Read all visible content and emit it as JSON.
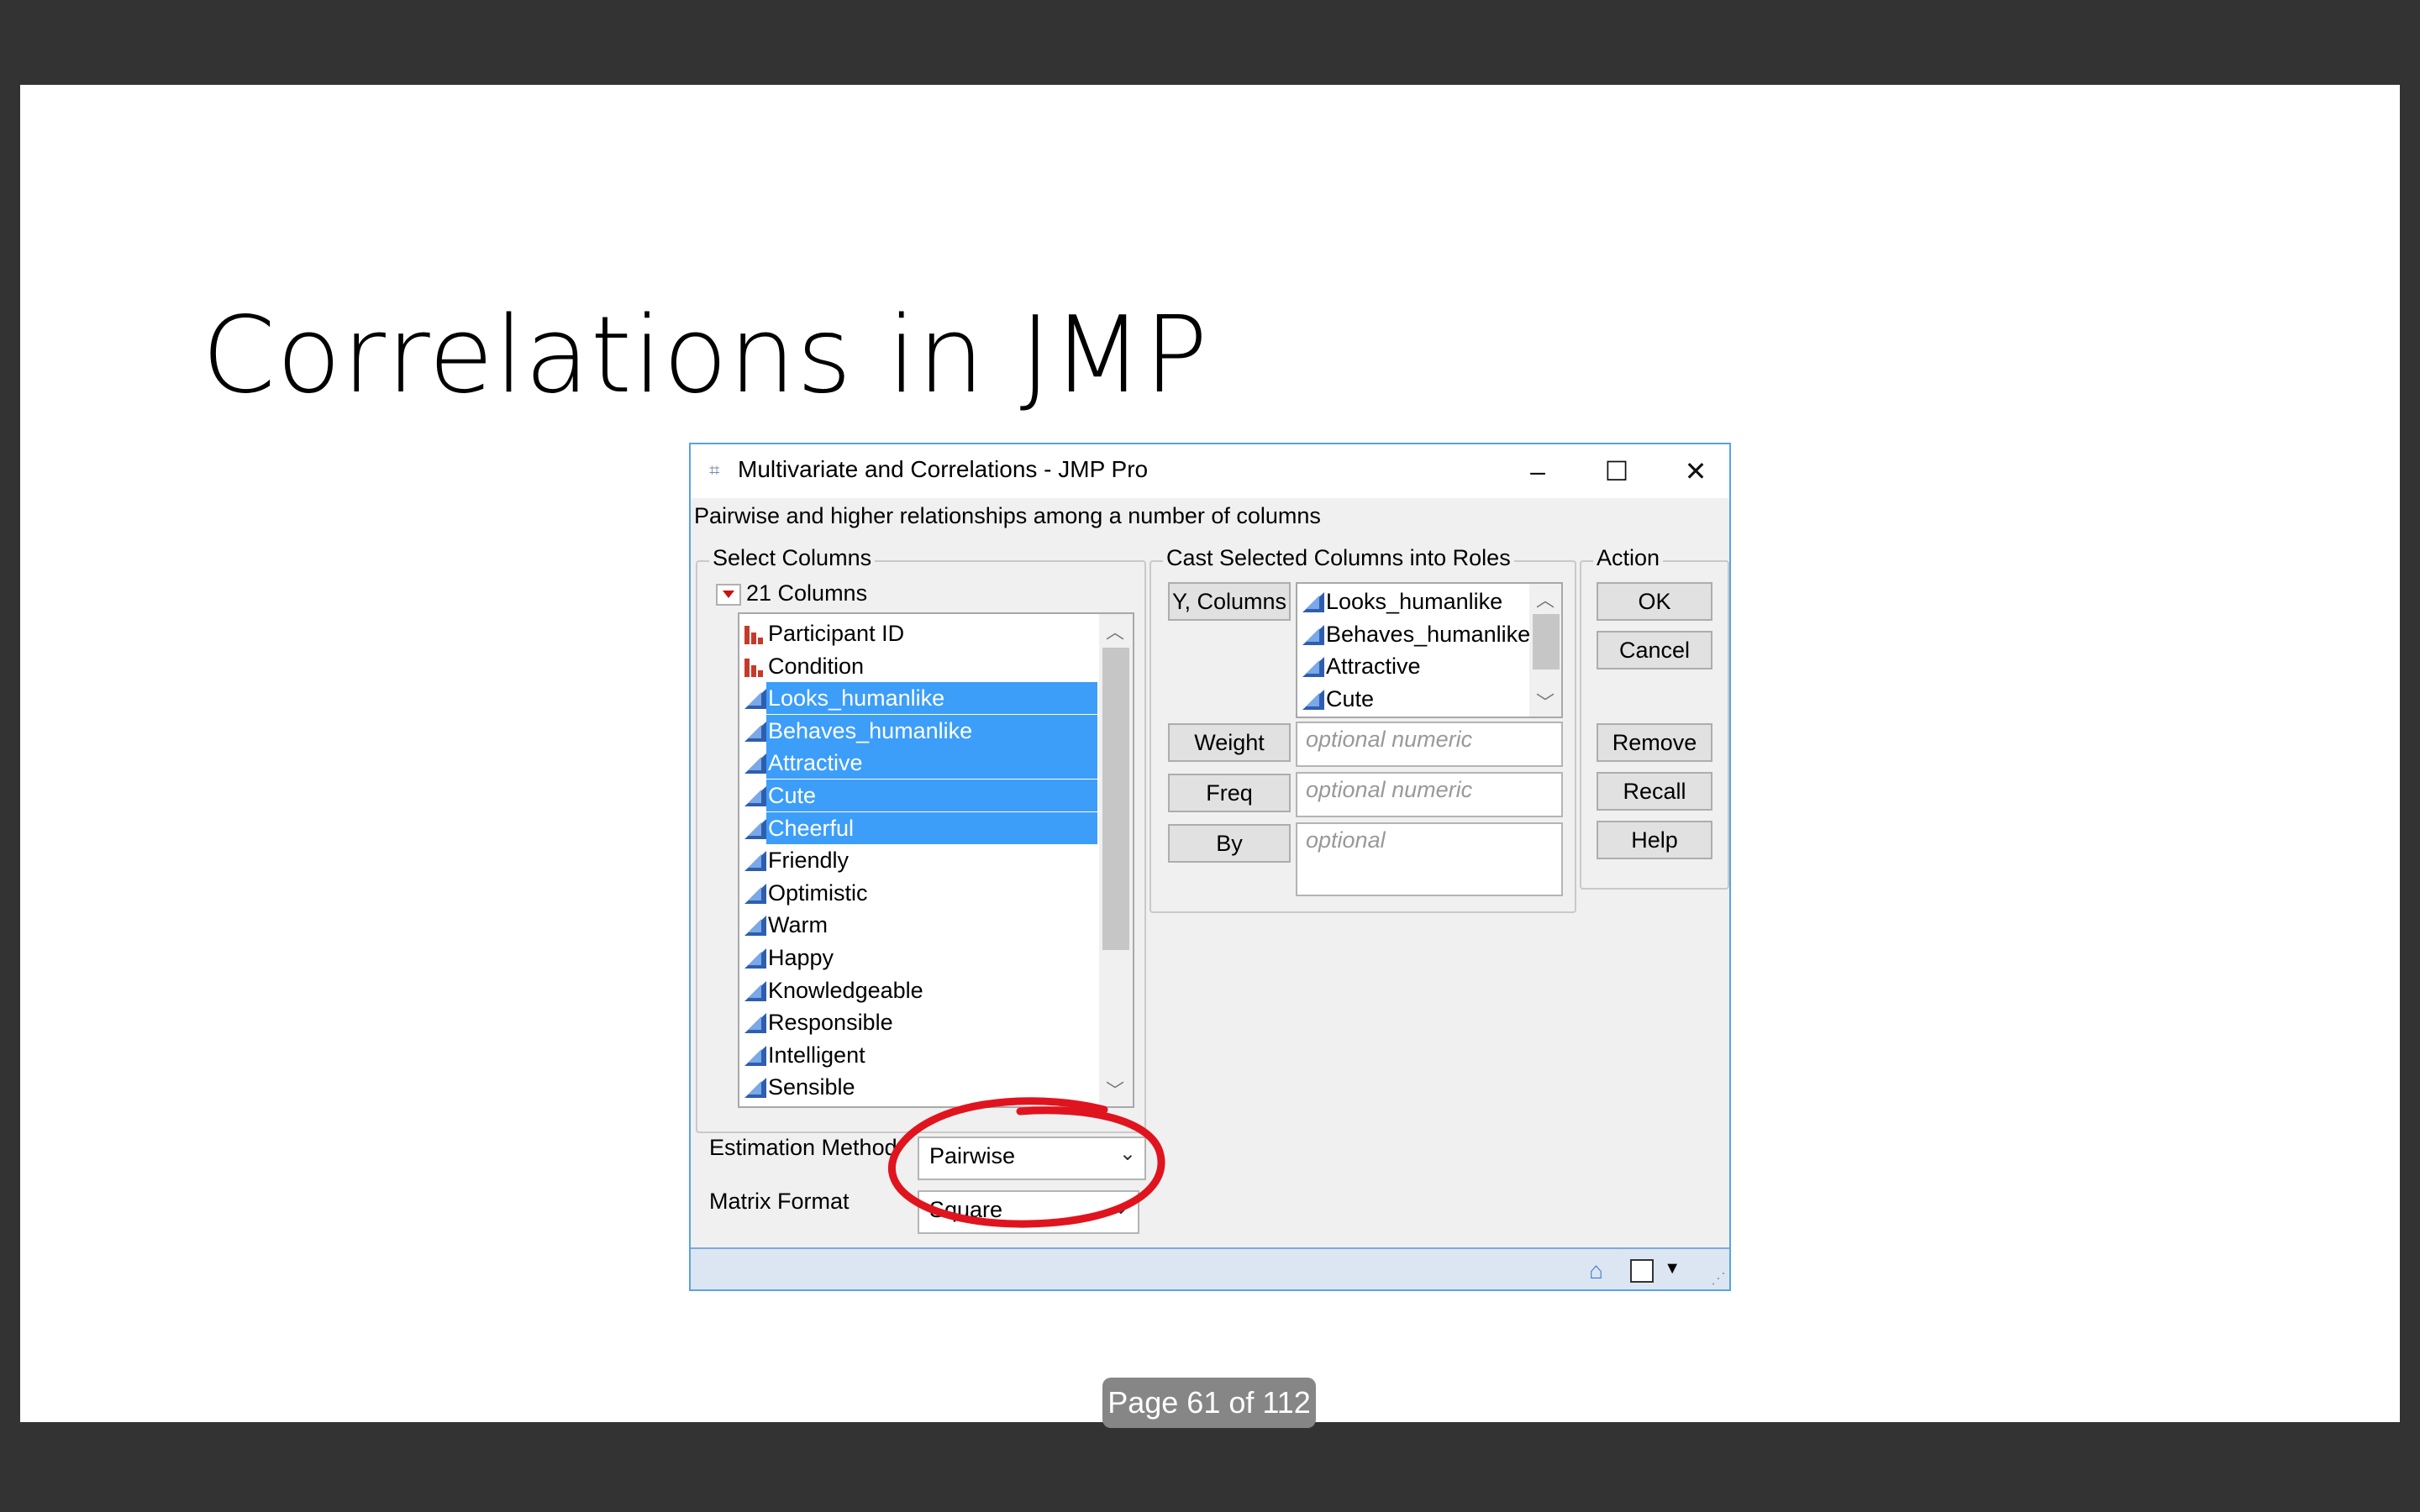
{
  "slide": {
    "title": "Correlations in JMP",
    "page_indicator": "Page 61 of 112"
  },
  "dialog": {
    "window_title": "Multivariate and Correlations - JMP Pro",
    "subtitle": "Pairwise and higher relationships among a number of columns",
    "icons": {
      "app": "app-icon",
      "minimize": "minimize-icon",
      "maximize": "maximize-icon",
      "close": "close-icon"
    },
    "select_columns": {
      "group_label": "Select Columns",
      "count_label": "21 Columns",
      "items": [
        {
          "label": "Participant ID",
          "type": "nominal",
          "selected": false
        },
        {
          "label": "Condition",
          "type": "nominal",
          "selected": false
        },
        {
          "label": "Looks_humanlike",
          "type": "continuous",
          "selected": true
        },
        {
          "label": "Behaves_humanlike",
          "type": "continuous",
          "selected": true
        },
        {
          "label": "Attractive",
          "type": "continuous",
          "selected": true
        },
        {
          "label": "Cute",
          "type": "continuous",
          "selected": true
        },
        {
          "label": "Cheerful",
          "type": "continuous",
          "selected": true
        },
        {
          "label": "Friendly",
          "type": "continuous",
          "selected": false
        },
        {
          "label": "Optimistic",
          "type": "continuous",
          "selected": false
        },
        {
          "label": "Warm",
          "type": "continuous",
          "selected": false
        },
        {
          "label": "Happy",
          "type": "continuous",
          "selected": false
        },
        {
          "label": "Knowledgeable",
          "type": "continuous",
          "selected": false
        },
        {
          "label": "Responsible",
          "type": "continuous",
          "selected": false
        },
        {
          "label": "Intelligent",
          "type": "continuous",
          "selected": false
        },
        {
          "label": "Sensible",
          "type": "continuous",
          "selected": false
        }
      ]
    },
    "cast_roles": {
      "group_label": "Cast Selected Columns into Roles",
      "y_columns_button": "Y, Columns",
      "y_items": [
        "Looks_humanlike",
        "Behaves_humanlike",
        "Attractive",
        "Cute"
      ],
      "weight_button": "Weight",
      "weight_placeholder": "optional numeric",
      "freq_button": "Freq",
      "freq_placeholder": "optional numeric",
      "by_button": "By",
      "by_placeholder": "optional"
    },
    "action": {
      "group_label": "Action",
      "ok": "OK",
      "cancel": "Cancel",
      "remove": "Remove",
      "recall": "Recall",
      "help": "Help"
    },
    "options": {
      "estimation_label": "Estimation Method",
      "estimation_value": "Pairwise",
      "matrix_label": "Matrix Format",
      "matrix_value": "Square"
    },
    "annotation_color": "#e0141e",
    "selection_color": "#3c9ef8"
  }
}
